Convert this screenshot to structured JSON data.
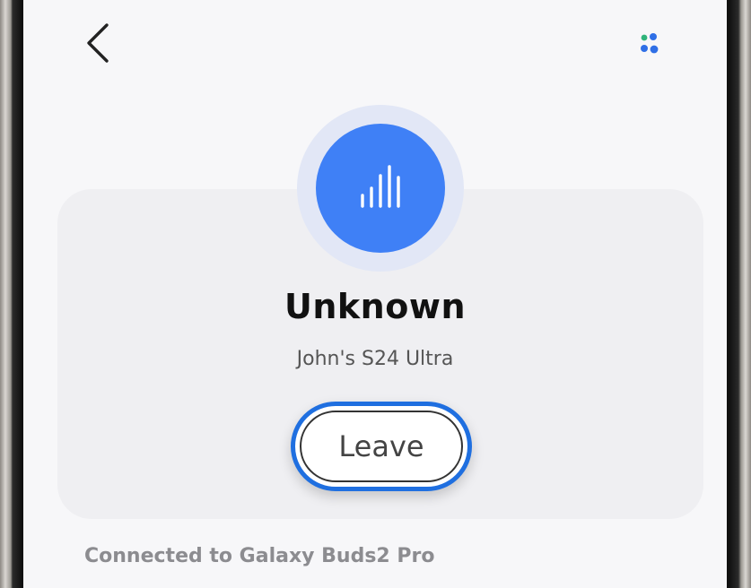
{
  "header": {
    "back_icon": "chevron-left-icon",
    "menu_icon": "dots-menu-icon"
  },
  "device": {
    "icon": "audio-bars-icon",
    "name": "Unknown",
    "owner": "John's S24 Ultra"
  },
  "actions": {
    "leave_label": "Leave"
  },
  "status": {
    "connected_text": "Connected to Galaxy Buds2 Pro"
  },
  "colors": {
    "accent": "#3f80f6",
    "highlight": "#1f6fe0",
    "dot_green": "#2fb37a",
    "dot_blue": "#2f6fe6"
  }
}
